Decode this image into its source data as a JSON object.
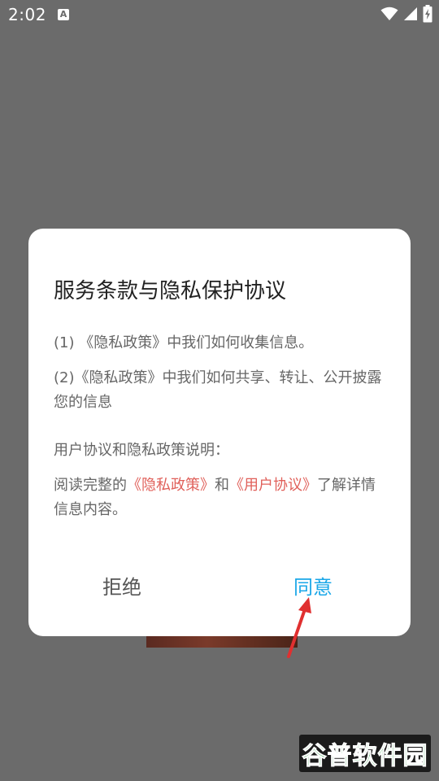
{
  "status_bar": {
    "time": "2:02",
    "notification_glyph": "A",
    "icons": [
      "wifi-icon",
      "signal-icon",
      "battery-charging-icon"
    ]
  },
  "dialog": {
    "title": "服务条款与隐私保护协议",
    "p1": "(1) 《隐私政策》中我们如何收集信息。",
    "p2": "(2)《隐私政策》中我们如何共享、转让、公开披露您的信息",
    "p3": "用户协议和隐私政策说明：",
    "p4_prefix": "阅读完整的",
    "p4_link_privacy": "《隐私政策》",
    "p4_middle": "和",
    "p4_link_user": "《用户协议》",
    "p4_suffix": "了解详情信息内容。",
    "reject_label": "拒绝",
    "agree_label": "同意"
  },
  "watermark": {
    "text": "谷普软件园"
  },
  "colors": {
    "backdrop": "#6b6b6b",
    "link": "#e0605a",
    "agree": "#1aa7e8",
    "arrow": "#e03030"
  }
}
